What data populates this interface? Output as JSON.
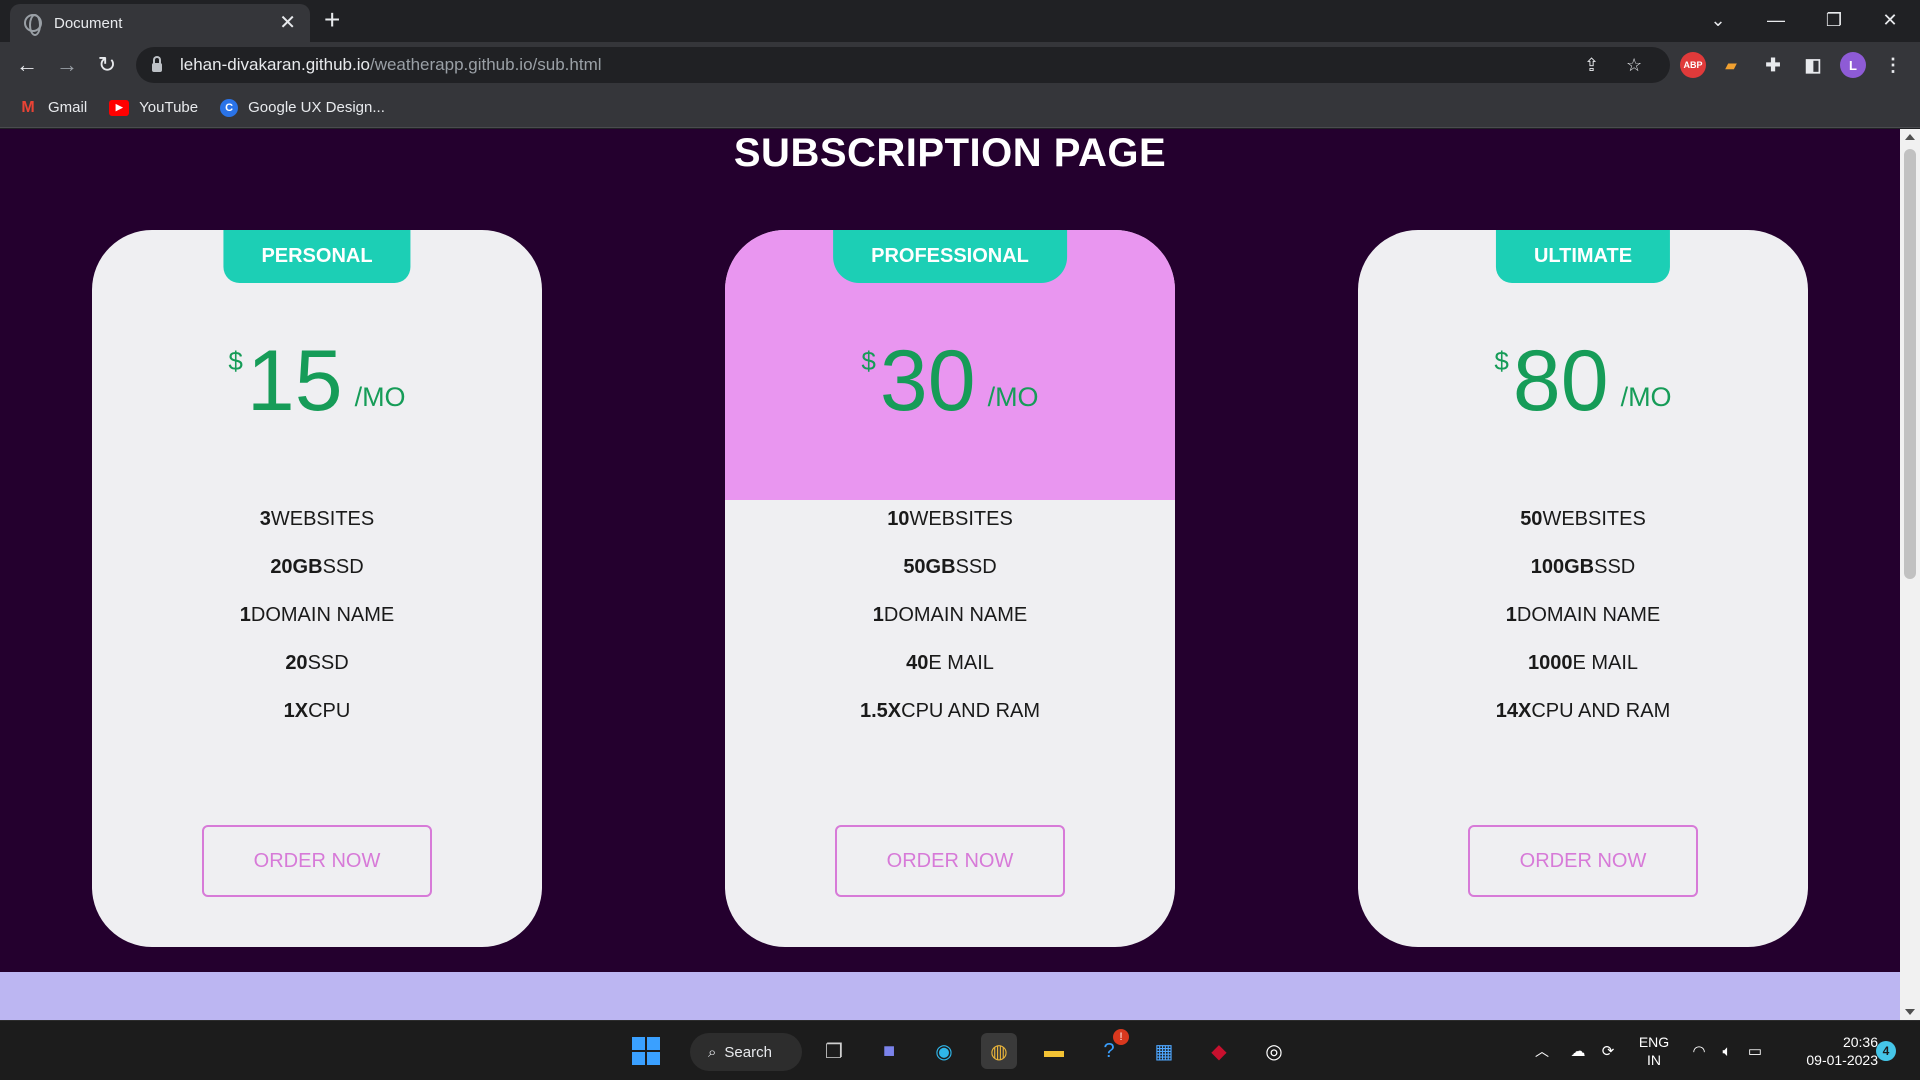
{
  "browser": {
    "tab_title": "Document",
    "url_host": "lehan-divakaran.github.io",
    "url_path": "/weatherapp.github.io/sub.html",
    "profile_initial": "L",
    "adblock_label": "ABP",
    "bookmarks": [
      {
        "label": "Gmail",
        "icon": "gmail-icon"
      },
      {
        "label": "YouTube",
        "icon": "youtube-icon"
      },
      {
        "label": "Google UX Design...",
        "icon": "coursera-icon"
      }
    ]
  },
  "page": {
    "title": "SUBSCRIPTION PAGE",
    "plans": [
      {
        "name": "PERSONAL",
        "currency": "$",
        "price": "15",
        "period": "/MO",
        "features": [
          {
            "value": "3",
            "label": "WEBSITES"
          },
          {
            "value": "20GB",
            "label": "SSD"
          },
          {
            "value": "1",
            "label": "DOMAIN NAME"
          },
          {
            "value": "20",
            "label": "SSD"
          },
          {
            "value": "1X",
            "label": "CPU"
          }
        ],
        "cta": "ORDER NOW"
      },
      {
        "name": "PROFESSIONAL",
        "currency": "$",
        "price": "30",
        "period": "/MO",
        "features": [
          {
            "value": "10",
            "label": "WEBSITES"
          },
          {
            "value": "50GB",
            "label": "SSD"
          },
          {
            "value": "1",
            "label": "DOMAIN NAME"
          },
          {
            "value": "40",
            "label": "E MAIL"
          },
          {
            "value": "1.5X",
            "label": "CPU AND RAM"
          }
        ],
        "cta": "ORDER NOW"
      },
      {
        "name": "ULTIMATE",
        "currency": "$",
        "price": "80",
        "period": "/MO",
        "features": [
          {
            "value": "50",
            "label": "WEBSITES"
          },
          {
            "value": "100GB",
            "label": "SSD"
          },
          {
            "value": "1",
            "label": "DOMAIN NAME"
          },
          {
            "value": "1000",
            "label": "E MAIL"
          },
          {
            "value": "14X",
            "label": "CPU AND RAM"
          }
        ],
        "cta": "ORDER NOW"
      }
    ]
  },
  "colors": {
    "page_bg": "#24002e",
    "card_bg": "#efeff2",
    "highlight": "#e996f0",
    "tag": "#1ccfb5",
    "price": "#169c58",
    "button": "#d77ad8",
    "footer": "#bcb6f2"
  },
  "taskbar": {
    "search_label": "Search",
    "language": "ENG",
    "region": "IN",
    "time": "20:36",
    "date": "09-01-2023",
    "notification_count": "4",
    "help_badge": "!"
  }
}
